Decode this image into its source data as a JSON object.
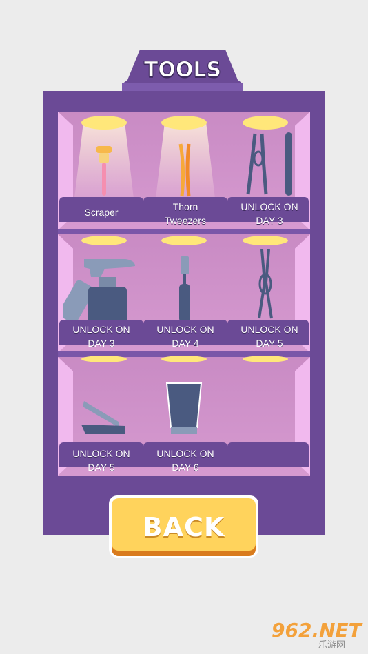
{
  "header": {
    "title": "TOOLS"
  },
  "shelves": [
    {
      "items": [
        {
          "label": "Scraper",
          "lit": true
        },
        {
          "label": "Thorn\nTweezers",
          "lit": true
        },
        {
          "label": "UNLOCK ON\nDAY 3",
          "lit": false
        }
      ]
    },
    {
      "items": [
        {
          "label": "UNLOCK ON\nDAY 3",
          "lit": false
        },
        {
          "label": "UNLOCK ON\nDAY 4",
          "lit": false
        },
        {
          "label": "UNLOCK ON\nDAY 5",
          "lit": false
        }
      ]
    },
    {
      "items": [
        {
          "label": "UNLOCK ON\nDAY 5",
          "lit": false
        },
        {
          "label": "UNLOCK ON\nDAY 6",
          "lit": false
        },
        {
          "label": "",
          "lit": false
        }
      ]
    }
  ],
  "back_button": {
    "label": "BACK"
  },
  "watermark": {
    "brand": "962.NET",
    "sub": "乐游网"
  },
  "colors": {
    "cabinet": "#6b4a96",
    "shelf": "#c98bc4",
    "lamp": "#ffe77a",
    "button": "#ffd35c",
    "button_shadow": "#d97b1d",
    "tool": "#4a5a80"
  }
}
